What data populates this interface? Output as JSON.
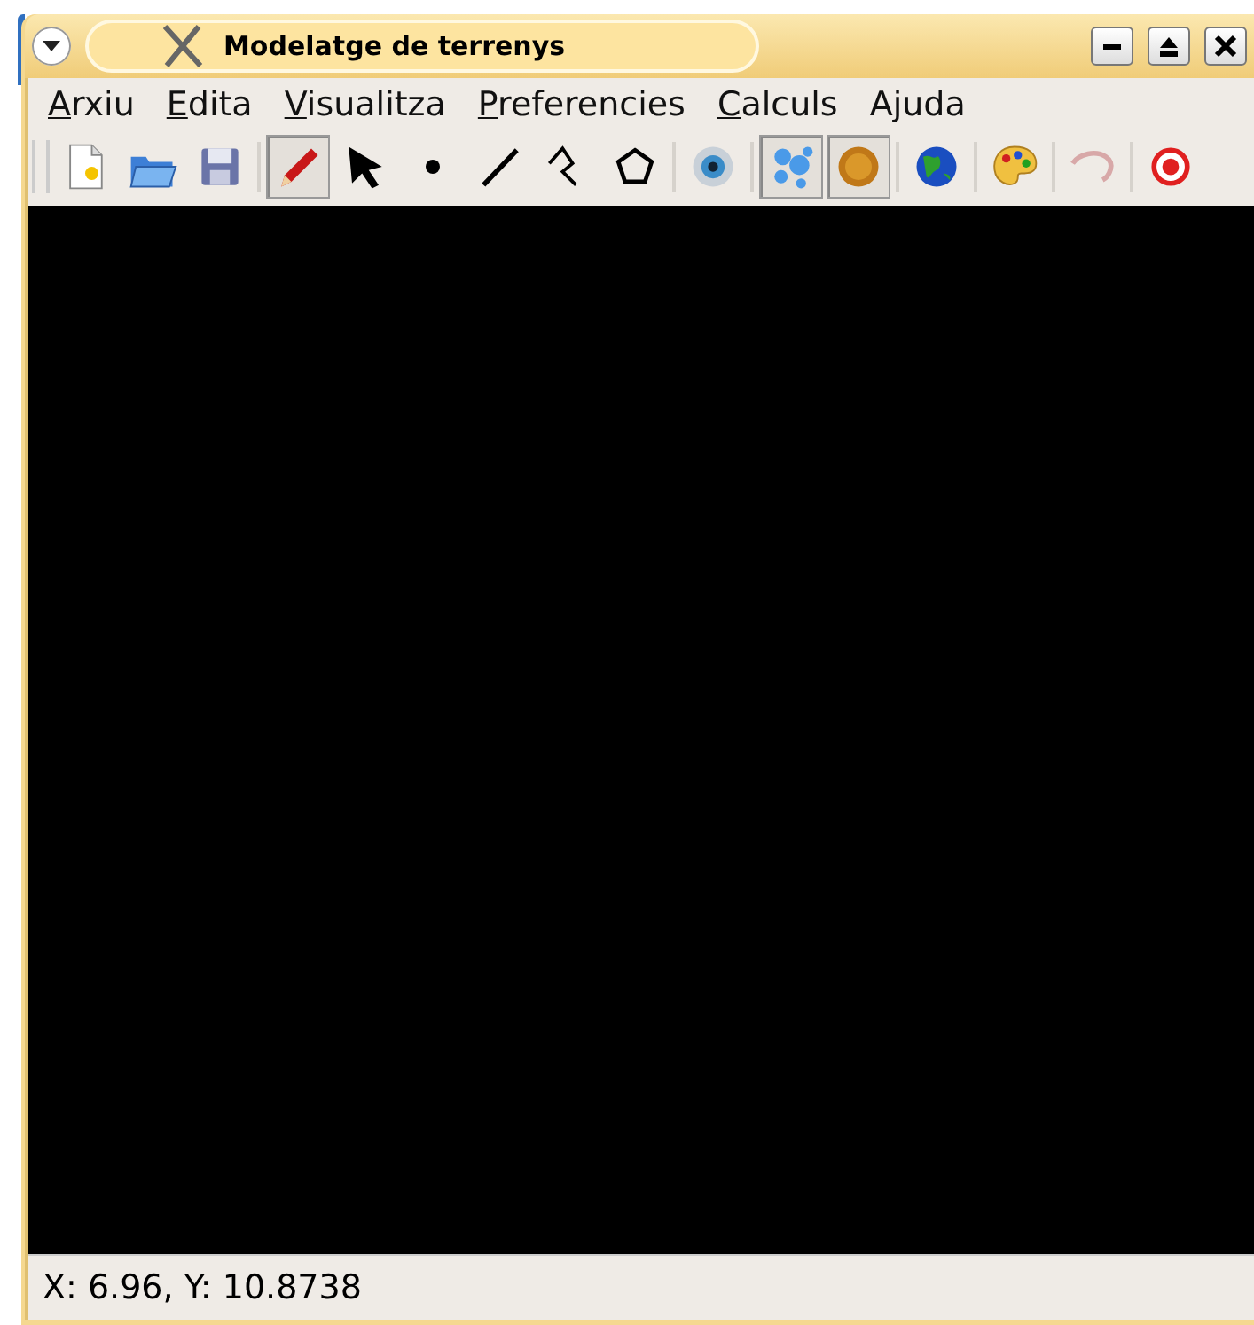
{
  "window": {
    "title": "Modelatge de terrenys"
  },
  "menu": [
    {
      "key": "A",
      "after": "rxiu"
    },
    {
      "key": "E",
      "after": "dita"
    },
    {
      "key": "V",
      "after": "isualitza"
    },
    {
      "key": "P",
      "after": "referencies"
    },
    {
      "key": "C",
      "after": "alculs"
    },
    {
      "text": "Ajuda"
    }
  ],
  "toolbar": [
    {
      "kind": "new",
      "selected": false
    },
    {
      "kind": "open",
      "selected": false
    },
    {
      "kind": "save",
      "selected": false
    },
    {
      "kind": "separator"
    },
    {
      "kind": "pencil",
      "selected": true
    },
    {
      "kind": "arrow",
      "selected": false
    },
    {
      "kind": "point",
      "selected": false
    },
    {
      "kind": "line",
      "selected": false
    },
    {
      "kind": "polyline",
      "selected": false
    },
    {
      "kind": "polygon",
      "selected": false
    },
    {
      "kind": "separator"
    },
    {
      "kind": "eye",
      "selected": false
    },
    {
      "kind": "separator"
    },
    {
      "kind": "bubbles",
      "selected": true
    },
    {
      "kind": "texture",
      "selected": true
    },
    {
      "kind": "separator"
    },
    {
      "kind": "globe",
      "selected": false
    },
    {
      "kind": "separator"
    },
    {
      "kind": "palette",
      "selected": false
    },
    {
      "kind": "separator"
    },
    {
      "kind": "curve",
      "selected": false
    },
    {
      "kind": "separator"
    },
    {
      "kind": "record",
      "selected": false
    }
  ],
  "status_bar": {
    "text": "X: 6.96, Y: 10.8738"
  }
}
